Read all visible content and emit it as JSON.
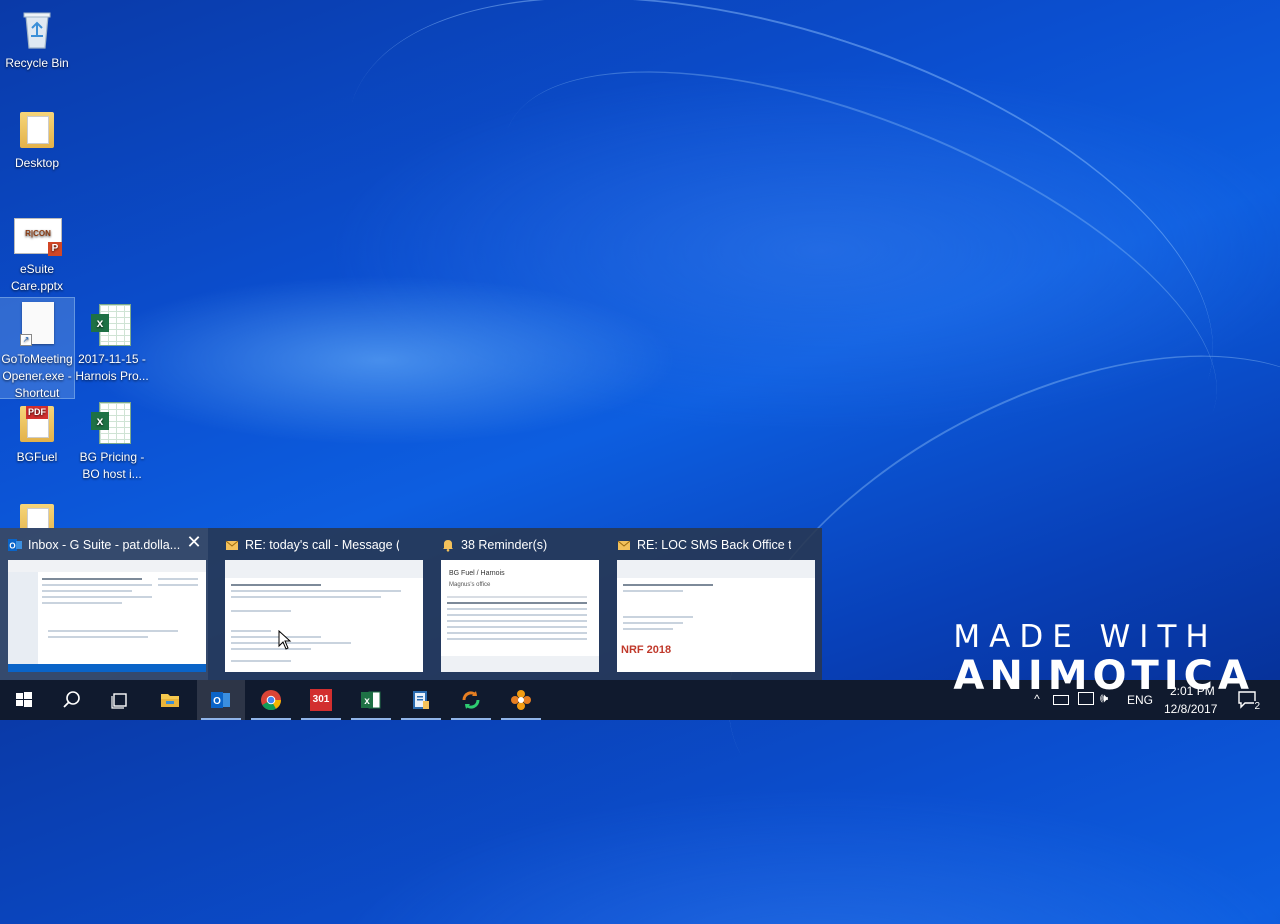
{
  "desktop": {
    "icons": [
      {
        "label": "Recycle Bin",
        "icon": "recycle-bin-icon"
      },
      {
        "label": "Desktop",
        "icon": "folder-icon"
      },
      {
        "label": "eSuite Care.pptx",
        "icon": "powerpoint-file-icon",
        "thumb_text": "R|CON"
      },
      {
        "label": "GoToMeeting Opener.exe - Shortcut",
        "label_lines": [
          "GoToMeeting",
          "Opener.exe -",
          "Shortcut"
        ],
        "icon": "shortcut-file-icon",
        "selected": true
      },
      {
        "label": "2017-11-15 - Harnois Pro...",
        "label_lines": [
          "2017-11-15 -",
          "Harnois Pro..."
        ],
        "icon": "excel-file-icon"
      },
      {
        "label": "BGFuel",
        "icon": "pdf-folder-icon",
        "badge": "PDF"
      },
      {
        "label": "BG Pricing - BO host i...",
        "label_lines": [
          "BG Pricing -",
          "BO host i..."
        ],
        "icon": "excel-file-icon"
      },
      {
        "label": "",
        "icon": "folder-icon"
      }
    ]
  },
  "preview": {
    "windows": [
      {
        "title": "Inbox - G Suite - pat.dolla...",
        "icon": "outlook-icon",
        "hovered": true,
        "close": "✕"
      },
      {
        "title": "RE: today's call - Message (HT...",
        "icon": "envelope-icon"
      },
      {
        "title": "38 Reminder(s)",
        "icon": "bell-icon",
        "thumb_lines": [
          "BG Fuel / Harnois",
          "Magnus's office"
        ]
      },
      {
        "title": "RE: LOC SMS Back Office to IB...",
        "icon": "envelope-icon",
        "thumb_text": "NRF 2018"
      }
    ]
  },
  "taskbar": {
    "apps": [
      {
        "name": "start",
        "icon": "windows-start-icon"
      },
      {
        "name": "search",
        "icon": "search-icon"
      },
      {
        "name": "task-view",
        "icon": "task-view-icon"
      },
      {
        "name": "file-explorer",
        "icon": "folder-icon"
      },
      {
        "name": "outlook",
        "icon": "outlook-icon",
        "active": true,
        "hovered": true
      },
      {
        "name": "chrome",
        "icon": "chrome-icon",
        "active": true
      },
      {
        "name": "app-red",
        "icon": "red-app-icon",
        "active": true,
        "text": "301"
      },
      {
        "name": "excel",
        "icon": "excel-icon",
        "active": true
      },
      {
        "name": "notepad",
        "icon": "document-app-icon",
        "active": true
      },
      {
        "name": "app-green",
        "icon": "sync-app-icon",
        "active": true
      },
      {
        "name": "app-orange",
        "icon": "flower-app-icon",
        "active": true
      }
    ],
    "tray": {
      "language": "ENG",
      "time": "2:01 PM",
      "date": "12/8/2017",
      "notifications": "2"
    }
  },
  "watermark": {
    "line1": "MADE WITH",
    "line2": "ANIMOTICA"
  }
}
